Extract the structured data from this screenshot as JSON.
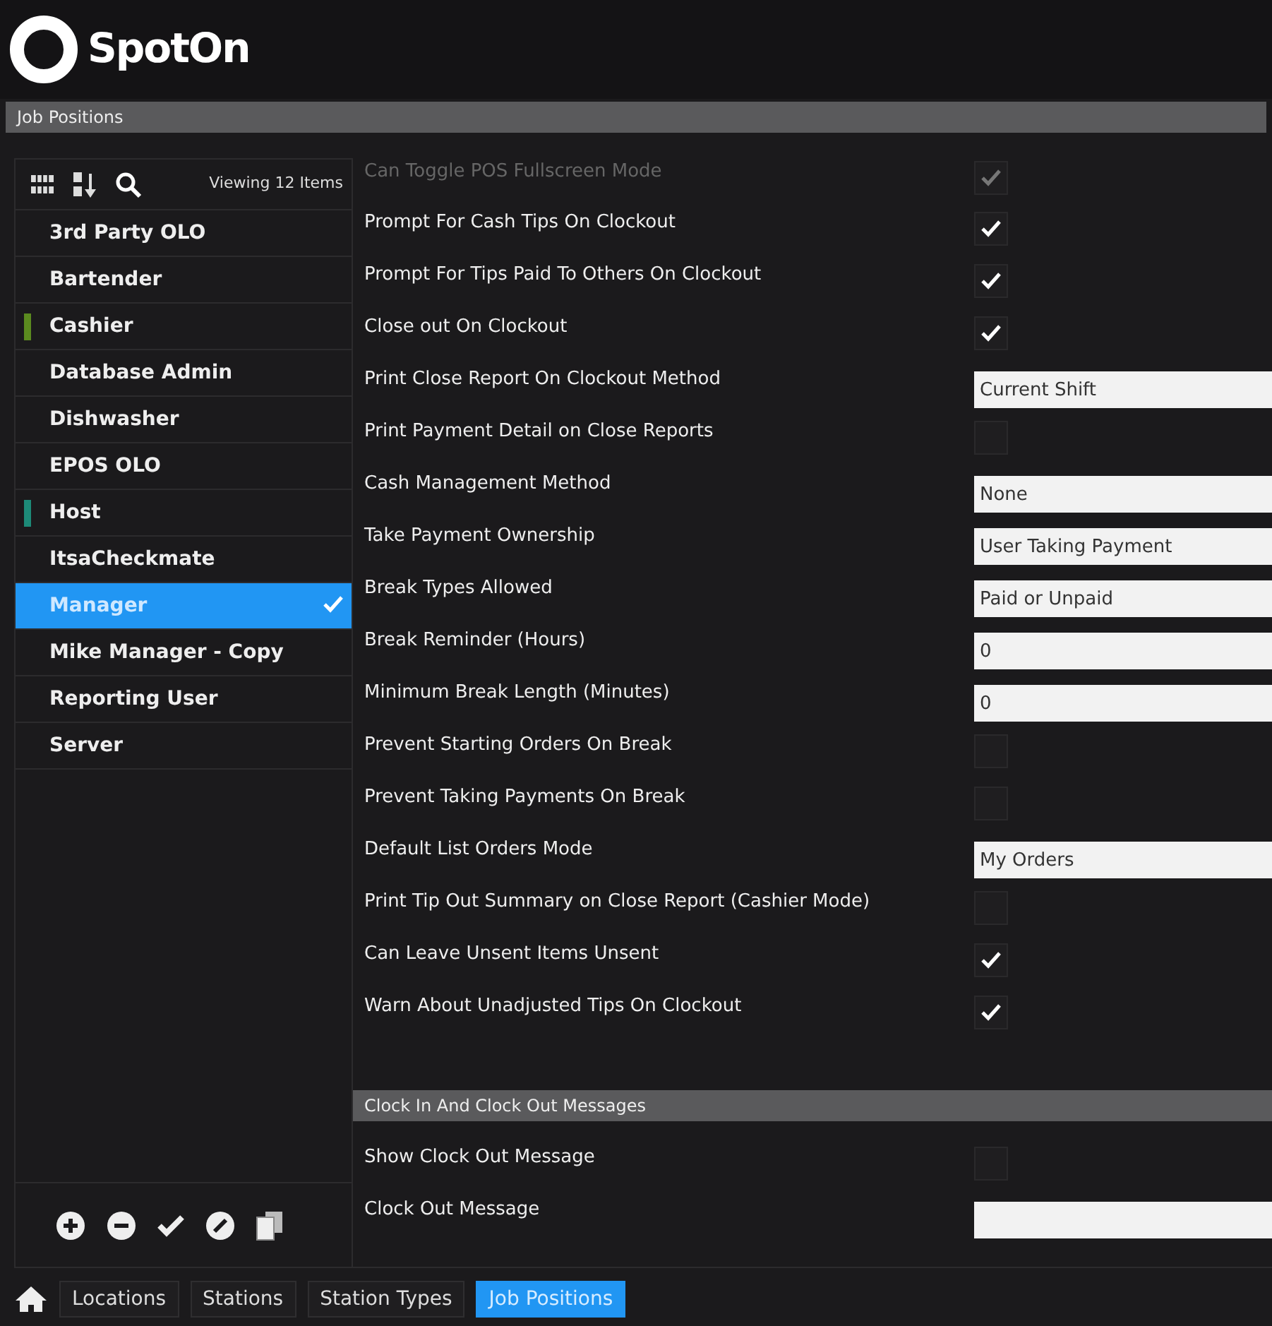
{
  "brand": {
    "name": "SpotOn"
  },
  "title_bar": {
    "title": "Job Positions"
  },
  "list_toolbar": {
    "count": "Viewing 12 Items"
  },
  "positions": [
    {
      "label": "3rd Party OLO",
      "selected": false
    },
    {
      "label": "Bartender",
      "selected": false
    },
    {
      "label": "Cashier",
      "selected": false,
      "color": "#5b8a1f"
    },
    {
      "label": "Database Admin",
      "selected": false
    },
    {
      "label": "Dishwasher",
      "selected": false
    },
    {
      "label": "EPOS OLO",
      "selected": false
    },
    {
      "label": "Host",
      "selected": false,
      "color": "#1d8a78"
    },
    {
      "label": "ItsaCheckmate",
      "selected": false
    },
    {
      "label": "Manager",
      "selected": true
    },
    {
      "label": "Mike Manager - Copy",
      "selected": false
    },
    {
      "label": "Reporting User",
      "selected": false
    },
    {
      "label": "Server",
      "selected": false
    }
  ],
  "settings": [
    {
      "kind": "checkbox",
      "label": "Can Toggle POS Fullscreen Mode",
      "checked": true,
      "disabled": true
    },
    {
      "kind": "checkbox",
      "label": "Prompt For Cash Tips On Clockout",
      "checked": true
    },
    {
      "kind": "checkbox",
      "label": "Prompt For Tips Paid To Others On Clockout",
      "checked": true
    },
    {
      "kind": "checkbox",
      "label": "Close out On Clockout",
      "checked": true
    },
    {
      "kind": "field",
      "label": "Print Close Report On Clockout Method",
      "value": "Current Shift"
    },
    {
      "kind": "checkbox",
      "label": "Print Payment Detail on Close Reports",
      "checked": false
    },
    {
      "kind": "field",
      "label": "Cash Management Method",
      "value": "None"
    },
    {
      "kind": "field",
      "label": "Take Payment Ownership",
      "value": "User Taking Payment"
    },
    {
      "kind": "field",
      "label": "Break Types Allowed",
      "value": "Paid or Unpaid"
    },
    {
      "kind": "field",
      "label": "Break Reminder (Hours)",
      "value": "0"
    },
    {
      "kind": "field",
      "label": "Minimum Break Length (Minutes)",
      "value": "0"
    },
    {
      "kind": "checkbox",
      "label": "Prevent Starting Orders On Break",
      "checked": false
    },
    {
      "kind": "checkbox",
      "label": "Prevent Taking Payments On Break",
      "checked": false
    },
    {
      "kind": "field",
      "label": "Default List Orders Mode",
      "value": "My Orders"
    },
    {
      "kind": "checkbox",
      "label": "Print Tip Out Summary on Close Report (Cashier Mode)",
      "checked": false
    },
    {
      "kind": "checkbox",
      "label": "Can Leave Unsent Items Unsent",
      "checked": true
    },
    {
      "kind": "checkbox",
      "label": "Warn About Unadjusted Tips On Clockout",
      "checked": true
    }
  ],
  "section": {
    "title": "Clock In And Clock Out Messages"
  },
  "section_settings": [
    {
      "kind": "checkbox",
      "label": "Show Clock Out Message",
      "checked": false
    },
    {
      "kind": "field",
      "label": "Clock Out Message"
    }
  ],
  "bottom_tabs": [
    {
      "label": "Locations",
      "selected": false
    },
    {
      "label": "Stations",
      "selected": false
    },
    {
      "label": "Station Types",
      "selected": false
    },
    {
      "label": "Job Positions",
      "selected": true
    }
  ]
}
